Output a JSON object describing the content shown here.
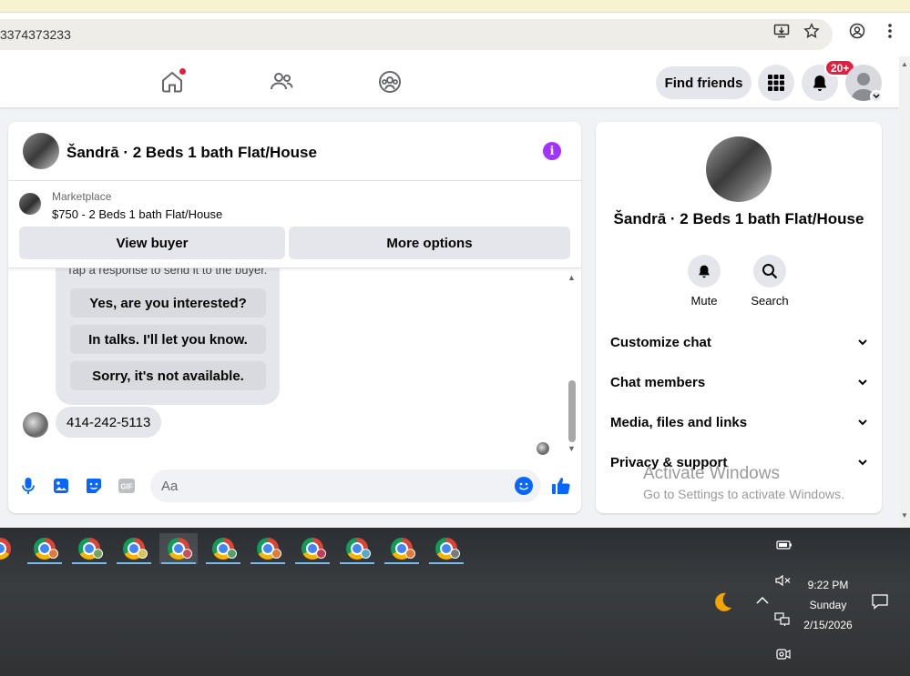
{
  "browser": {
    "url_fragment": "3374373233"
  },
  "header": {
    "find_friends": "Find friends",
    "notification_badge": "20+"
  },
  "chat": {
    "title": "Šandrā · 2 Beds 1 bath Flat/House",
    "listing_source": "Marketplace",
    "listing_price": "$750 - 2 Beds 1 bath Flat/House",
    "view_buyer": "View buyer",
    "more_options": "More options",
    "hint": "Tap a response to send it to the buyer.",
    "quick_replies": [
      "Yes, are you interested?",
      "In talks. I'll let you know.",
      "Sorry, it's not available."
    ],
    "phone_message": "414-242-5113",
    "input_placeholder": "Aa"
  },
  "info": {
    "title": "Šandrā · 2 Beds 1 bath Flat/House",
    "mute": "Mute",
    "search": "Search",
    "sections": [
      "Customize chat",
      "Chat members",
      "Media, files and links",
      "Privacy & support"
    ]
  },
  "watermark": {
    "line1": "Activate Windows",
    "line2": "Go to Settings to activate Windows."
  },
  "taskbar": {
    "time": "9:22 PM",
    "day": "Sunday",
    "date": "2/15/2026",
    "profile_colors": [
      "#7a7a7a",
      "#e0793a",
      "#7aa35a",
      "#d9c25b",
      "#d04a5a",
      "#55a06a",
      "#e0793a",
      "#c23a55",
      "#5aa7c8",
      "#e0793a"
    ]
  },
  "colors": {
    "accent": "#0866ff",
    "info": "#a033ff",
    "badge": "#e41e3f"
  }
}
